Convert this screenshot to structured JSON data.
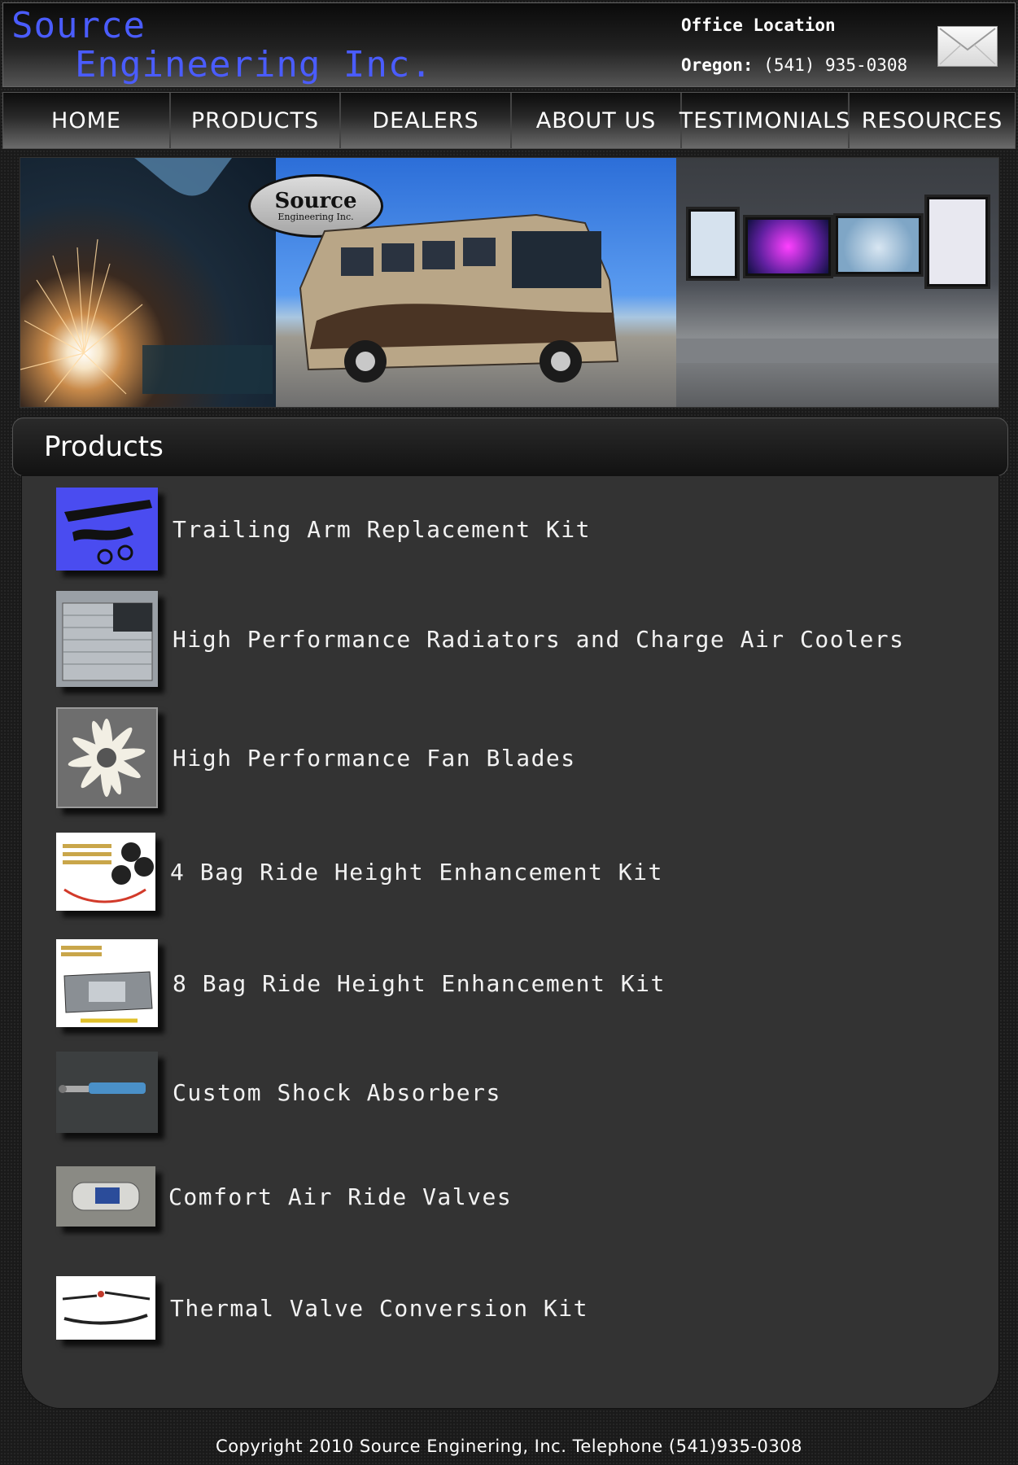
{
  "header": {
    "logo_line1": "Source",
    "logo_line2": "Engineering Inc.",
    "office_title": "Office Location",
    "office_label": "Oregon:",
    "office_phone": "(541) 935-0308",
    "mail_icon": "envelope-icon"
  },
  "nav": {
    "items": [
      {
        "label": "HOME"
      },
      {
        "label": "PRODUCTS"
      },
      {
        "label": "DEALERS"
      },
      {
        "label": "ABOUT US"
      },
      {
        "label": "TESTIMONIALS"
      },
      {
        "label": "RESOURCES"
      }
    ]
  },
  "banner": {
    "logo_text1": "Source",
    "logo_text2": "Engineering Inc."
  },
  "products": {
    "heading": "Products",
    "items": [
      {
        "title": "Trailing Arm Replacement Kit",
        "thumb_color": "#4a4cf0"
      },
      {
        "title": "High Performance Radiators and Charge Air Coolers",
        "thumb_color": "#9aa0a6"
      },
      {
        "title": "High Performance Fan Blades",
        "thumb_color": "#6e6e6e"
      },
      {
        "title": "4 Bag Ride Height Enhancement Kit",
        "thumb_color": "#ffffff"
      },
      {
        "title": "8 Bag Ride Height Enhancement Kit",
        "thumb_color": "#ffffff"
      },
      {
        "title": "Custom Shock Absorbers",
        "thumb_color": "#3c3f40"
      },
      {
        "title": "Comfort Air Ride Valves",
        "thumb_color": "#8a8a84"
      },
      {
        "title": "Thermal Valve Conversion Kit",
        "thumb_color": "#ffffff"
      }
    ]
  },
  "footer": {
    "text": "Copyright 2010 Source Enginering, Inc. Telephone (541)935-0308"
  },
  "colors": {
    "logo_blue": "#4a5cff",
    "content_bg": "#333333"
  }
}
